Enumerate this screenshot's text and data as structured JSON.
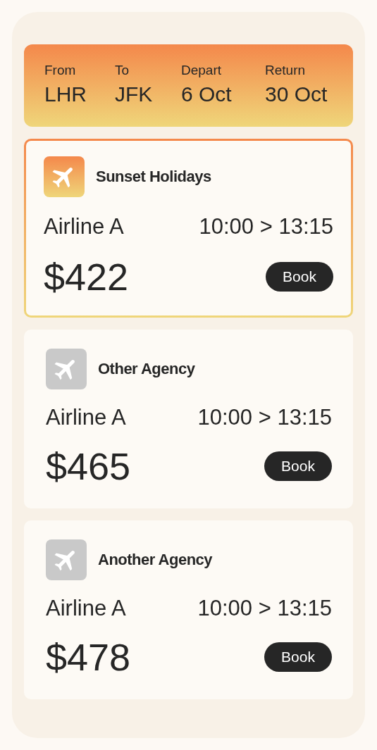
{
  "search": {
    "fields": [
      {
        "label": "From",
        "value": "LHR"
      },
      {
        "label": "To",
        "value": "JFK"
      },
      {
        "label": "Depart",
        "value": "6 Oct"
      },
      {
        "label": "Return",
        "value": "30 Oct"
      }
    ]
  },
  "offers": [
    {
      "agency": "Sunset Holidays",
      "selected": true,
      "airline": "Airline A",
      "times": "10:00 > 13:15",
      "price": "$422",
      "button": "Book"
    },
    {
      "agency": "Other Agency",
      "selected": false,
      "airline": "Airline A",
      "times": "10:00 > 13:15",
      "price": "$465",
      "button": "Book"
    },
    {
      "agency": "Another Agency",
      "selected": false,
      "airline": "Airline A",
      "times": "10:00 > 13:15",
      "price": "$478",
      "button": "Book"
    }
  ]
}
